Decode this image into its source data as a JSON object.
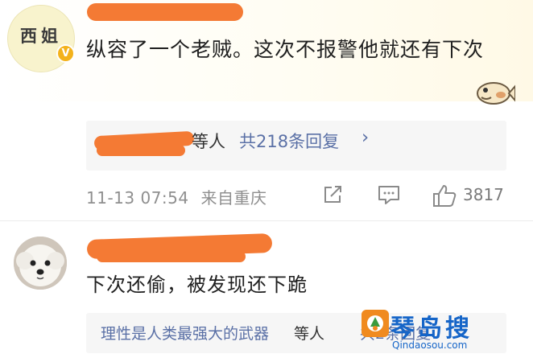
{
  "comment1": {
    "avatar_text": "西姐",
    "verified_icon": "verified-v-icon",
    "text": "纵容了一个老贼。这次不报警他就还有下次",
    "sticker_icon": "fish-sticker-icon",
    "replies": {
      "suffix": "等人",
      "count_text": "共218条回复",
      "chevron": "›"
    },
    "timestamp": "11-13 07:54",
    "location": "来自重庆",
    "actions": {
      "share_icon": "share-icon",
      "comment_icon": "comment-icon",
      "like_icon": "thumbs-up-icon",
      "like_count": "3817"
    }
  },
  "comment2": {
    "avatar_icon": "white-dog-avatar",
    "text": "下次还偷，被发现还下跪",
    "replies": {
      "name": "理性是人类最强大的武器",
      "suffix": "等人",
      "count_text": "共2条回复"
    }
  },
  "watermark": {
    "name": "琴岛搜",
    "url": "Qindaosou.com",
    "logo_icon": "qindaosou-logo-icon"
  },
  "colors": {
    "link": "#5a70a6",
    "redaction": "#f47a34",
    "badge": "#f3b21b",
    "watermark": "#1565c8"
  }
}
